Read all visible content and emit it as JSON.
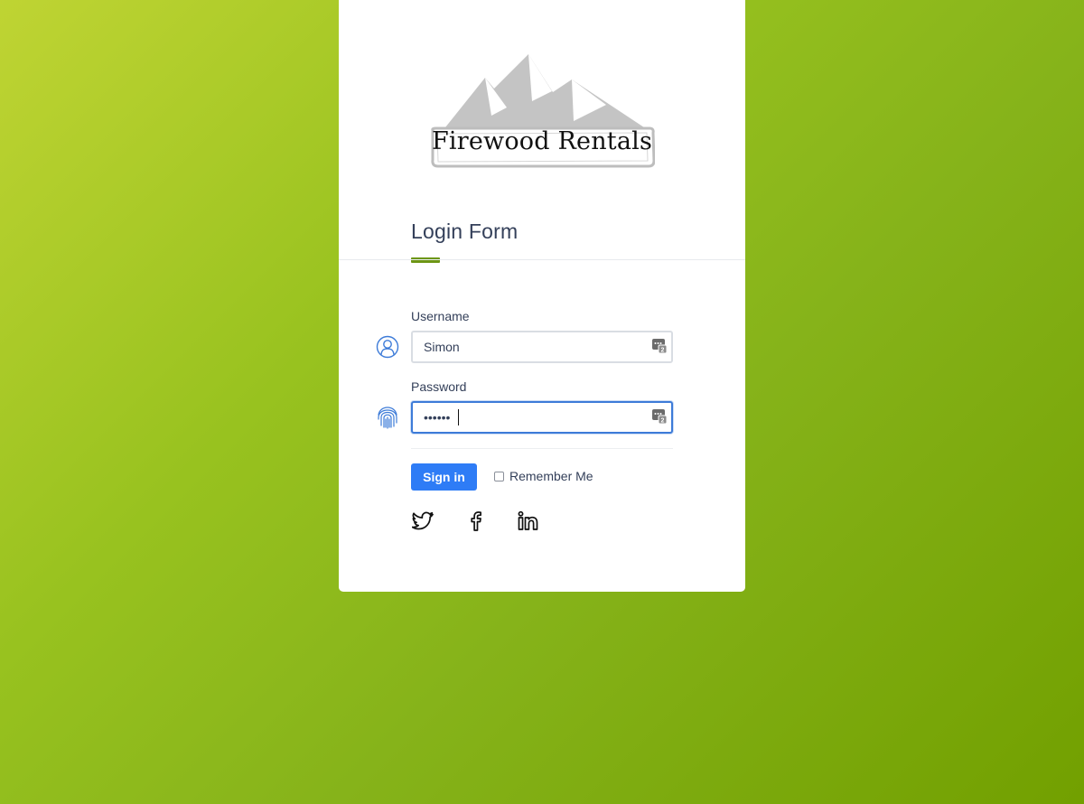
{
  "logo": {
    "name": "Firewood Rentals",
    "mountain_color": "#c4c4c4"
  },
  "form": {
    "title": "Login Form",
    "accent_color": "#6d9614",
    "username": {
      "label": "Username",
      "value": "Simon",
      "icon": "user-circle-icon"
    },
    "password": {
      "label": "Password",
      "value": "••••••",
      "icon": "fingerprint-icon",
      "focused": true
    },
    "password_manager_badge_icon": "password-manager-icon",
    "sign_in_label": "Sign in",
    "sign_in_color": "#2e7cf6",
    "remember_label": "Remember Me",
    "remember_checked": false
  },
  "social": [
    {
      "name": "twitter",
      "icon": "twitter-icon"
    },
    {
      "name": "facebook",
      "icon": "facebook-icon"
    },
    {
      "name": "linkedin",
      "icon": "linkedin-icon"
    }
  ],
  "colors": {
    "background_gradient_start": "#bfd433",
    "background_gradient_end": "#72a000",
    "icon_blue": "#3d7bd8"
  }
}
